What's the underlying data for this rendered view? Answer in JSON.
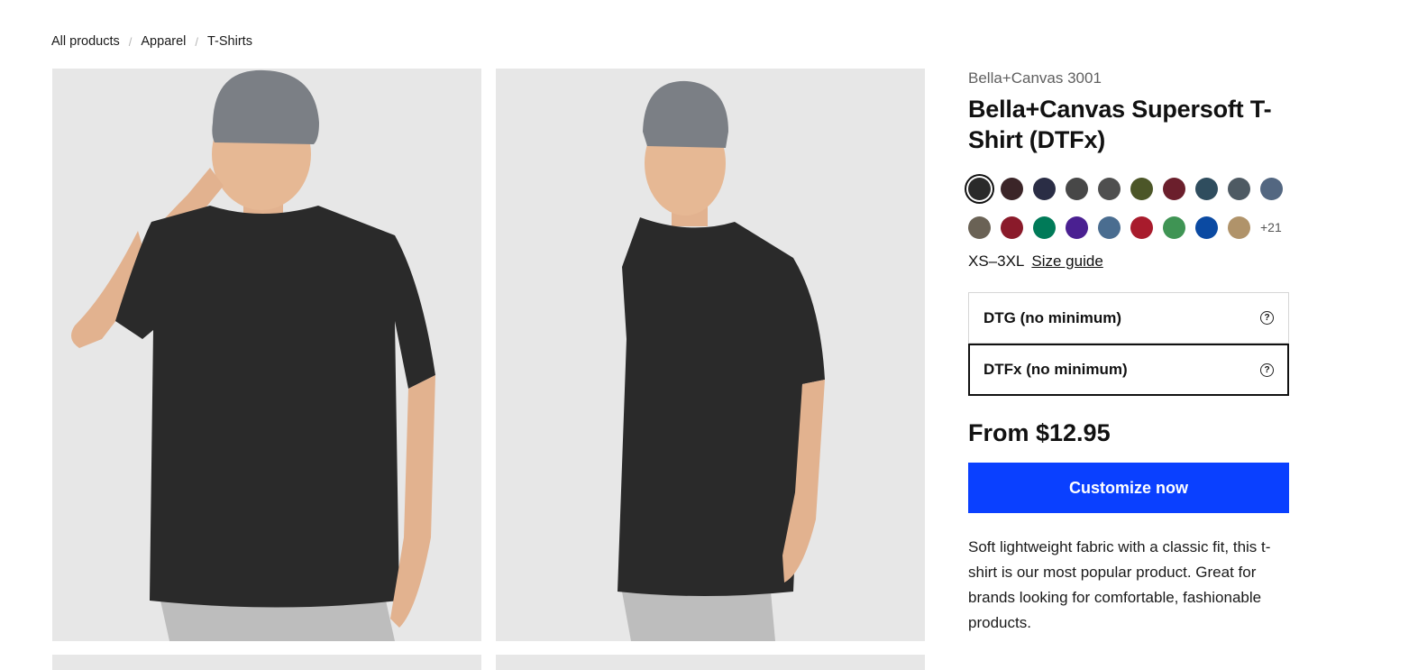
{
  "breadcrumb": {
    "items": [
      "All products",
      "Apparel",
      "T-Shirts"
    ],
    "separator": "/"
  },
  "product": {
    "brand_line": "Bella+Canvas 3001",
    "title": "Bella+Canvas Supersoft T-Shirt (DTFx)",
    "colors_row1": [
      "#2a2a2a",
      "#3b2528",
      "#2a2d45",
      "#474747",
      "#4f4f4f",
      "#4c5628",
      "#6b1f2c",
      "#2f4d5e",
      "#4e5a63",
      "#536781"
    ],
    "colors_row2": [
      "#6a6255",
      "#8a1a2a",
      "#007a58",
      "#4a2091",
      "#4a6d90",
      "#a81b2c",
      "#3f9454",
      "#0b4aa2",
      "#b0936a"
    ],
    "more_colors": "+21",
    "sizes": "XS–3XL",
    "size_guide": "Size guide",
    "print_options": [
      {
        "label": "DTG (no minimum)",
        "active": false
      },
      {
        "label": "DTFx (no minimum)",
        "active": true
      }
    ],
    "help_icon": "?",
    "price": "From $12.95",
    "cta_label": "Customize now",
    "description": "Soft lightweight fabric with a classic fit, this t-shirt is our most popular product. Great for brands looking for comfortable, fashionable products."
  },
  "colors": {
    "accent": "#0a40ff",
    "tile_bg": "#e7e7e7"
  }
}
